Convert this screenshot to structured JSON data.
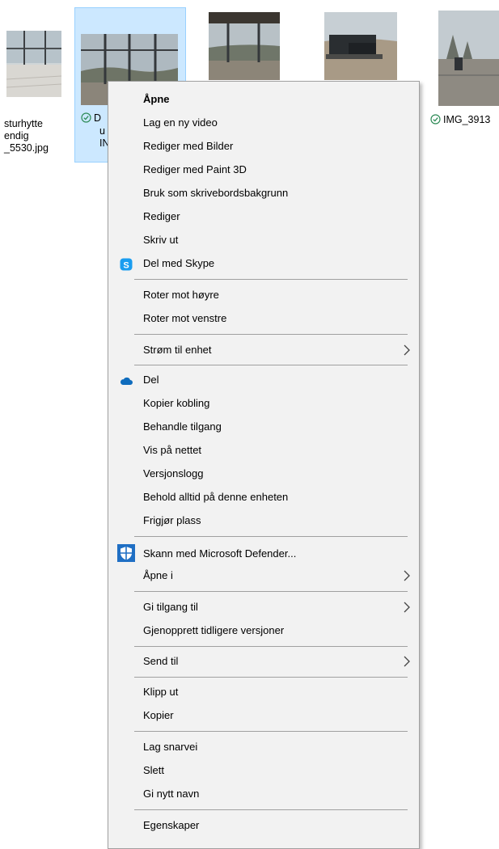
{
  "files": [
    {
      "line1": "sturhytte",
      "line2": "endig",
      "line3": "_5530.jpg"
    },
    {
      "line1": "D",
      "line2": "u",
      "line3": "IN"
    },
    {
      "line1": "IMG_3913"
    }
  ],
  "menu": {
    "items": {
      "open": "Åpne",
      "new_video": "Lag en ny video",
      "edit_photos": "Rediger med Bilder",
      "edit_paint3d": "Rediger med Paint 3D",
      "set_wallpaper": "Bruk som skrivebordsbakgrunn",
      "edit": "Rediger",
      "print": "Skriv ut",
      "share_skype": "Del med Skype",
      "rotate_right": "Roter mot høyre",
      "rotate_left": "Roter mot venstre",
      "cast": "Strøm til enhet",
      "share": "Del",
      "copy_link": "Kopier kobling",
      "manage_access": "Behandle tilgang",
      "view_online": "Vis på nettet",
      "version_history": "Versjonslogg",
      "keep_on_device": "Behold alltid på denne enheten",
      "free_space": "Frigjør plass",
      "defender": "Skann med Microsoft Defender...",
      "open_with": "Åpne i",
      "give_access": "Gi tilgang til",
      "restore": "Gjenopprett tidligere versjoner",
      "send_to": "Send til",
      "cut": "Klipp ut",
      "copy": "Kopier",
      "shortcut": "Lag snarvei",
      "delete": "Slett",
      "rename": "Gi nytt navn",
      "properties": "Egenskaper"
    }
  },
  "colors": {
    "selection": "#cce8ff",
    "menu_bg": "#f2f2f2",
    "skype": "#1a9df0",
    "onedrive": "#0f6cbd",
    "sync_ok": "#2e8b57"
  }
}
